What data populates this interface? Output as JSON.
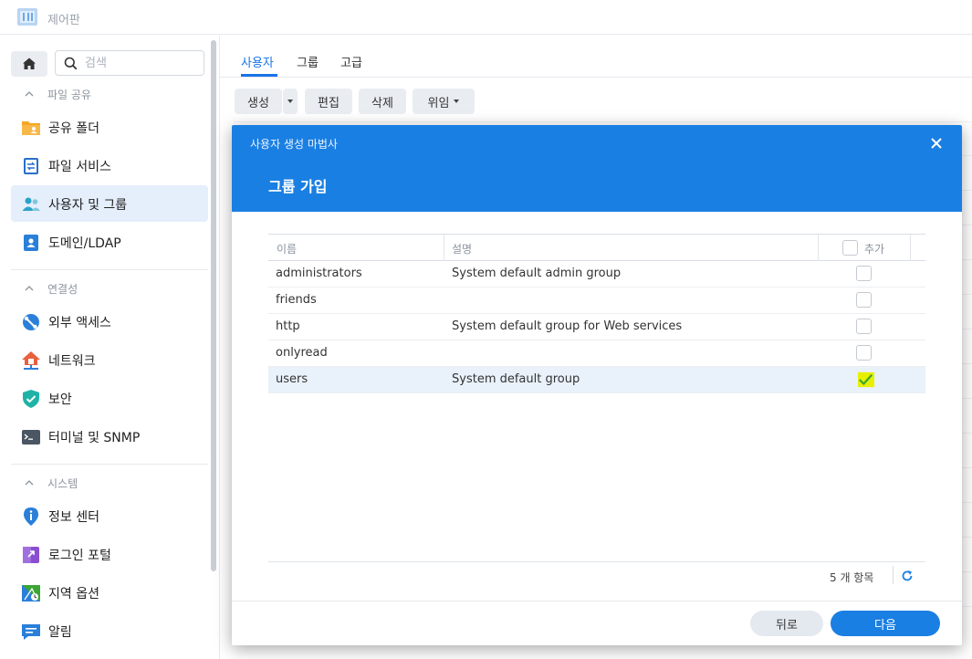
{
  "app": {
    "title": "제어판"
  },
  "sidebar": {
    "search_placeholder": "검색",
    "sections": [
      {
        "label": "파일 공유",
        "items": [
          {
            "label": "공유 폴더",
            "icon": "shared-folder-icon"
          },
          {
            "label": "파일 서비스",
            "icon": "file-services-icon"
          },
          {
            "label": "사용자 및 그룹",
            "icon": "user-group-icon",
            "active": true
          },
          {
            "label": "도메인/LDAP",
            "icon": "domain-ldap-icon"
          }
        ]
      },
      {
        "label": "연결성",
        "items": [
          {
            "label": "외부 액세스",
            "icon": "external-access-icon"
          },
          {
            "label": "네트워크",
            "icon": "network-icon"
          },
          {
            "label": "보안",
            "icon": "security-shield-icon"
          },
          {
            "label": "터미널 및 SNMP",
            "icon": "terminal-icon"
          }
        ]
      },
      {
        "label": "시스템",
        "items": [
          {
            "label": "정보 센터",
            "icon": "info-center-icon"
          },
          {
            "label": "로그인 포털",
            "icon": "login-portal-icon"
          },
          {
            "label": "지역 옵션",
            "icon": "regional-options-icon"
          },
          {
            "label": "알림",
            "icon": "notification-icon"
          }
        ]
      }
    ]
  },
  "main": {
    "tabs": [
      {
        "label": "사용자"
      },
      {
        "label": "그룹"
      },
      {
        "label": "고급"
      }
    ],
    "toolbar": {
      "create": "생성",
      "edit": "편집",
      "delete": "삭제",
      "delegate": "위임"
    }
  },
  "dialog": {
    "title": "사용자 생성 마법사",
    "step": "그룹 가입",
    "columns": {
      "name": "이름",
      "description": "설명",
      "add": "추가"
    },
    "rows": [
      {
        "name": "administrators",
        "description": "System default admin group",
        "checked": false
      },
      {
        "name": "friends",
        "description": "",
        "checked": false
      },
      {
        "name": "http",
        "description": "System default group for Web services",
        "checked": false
      },
      {
        "name": "onlyread",
        "description": "",
        "checked": false
      },
      {
        "name": "users",
        "description": "System default group",
        "checked": true
      }
    ],
    "count": "5 개 항목",
    "back": "뒤로",
    "next": "다음",
    "colors": {
      "accent": "#1a7fe3",
      "check_highlight": "#e8f000",
      "check_mark": "#3aa635"
    }
  }
}
